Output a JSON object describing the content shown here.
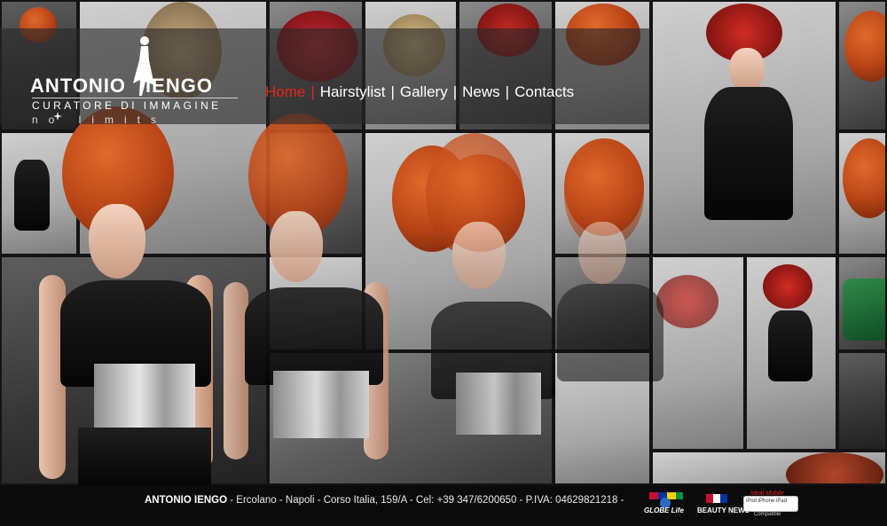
{
  "logo": {
    "title_first": "ANTONIO",
    "title_last": "IENGO",
    "subtitle": "CURATORE DI IMMAGINE",
    "tagline": "no limits"
  },
  "nav": {
    "items": [
      "Home",
      "Hairstylist",
      "Gallery",
      "News",
      "Contacts"
    ],
    "active": "Home"
  },
  "footer": {
    "name": "ANTONIO IENGO",
    "address": " - Ercolano - Napoli - Corso Italia, 159/A - Cel: +39 347/6200650 - P.IVA: 04629821218 -"
  },
  "badges": {
    "globe": "GLOBE Life",
    "beauty": "BEAUTY NEWS",
    "mobile_title": "Ideal Mobile",
    "mobile_devices": "iPod iPhone iPad",
    "mobile_sub": "Compatible"
  },
  "colors": {
    "accent": "#e8261c",
    "header_band": "rgba(40,40,40,0.62)",
    "footer_bg": "#0b0b0b"
  }
}
